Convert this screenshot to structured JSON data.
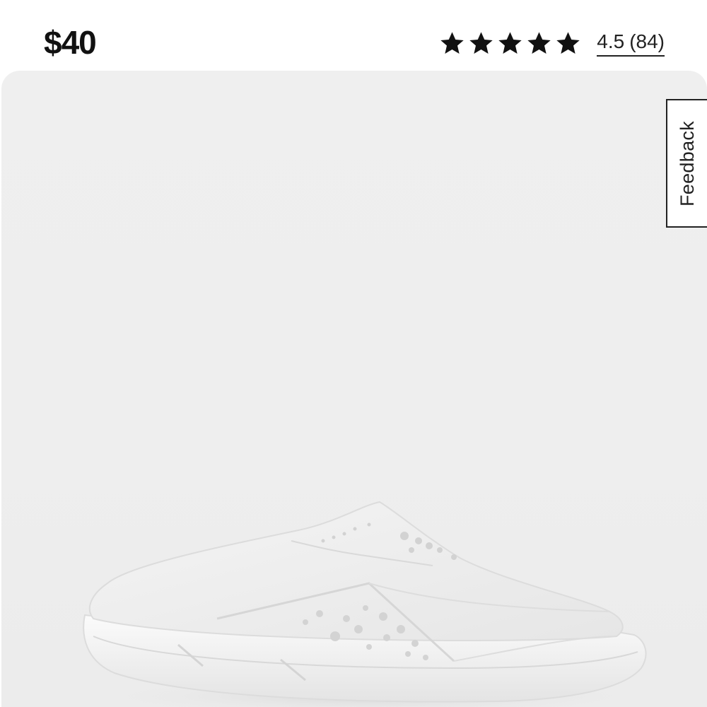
{
  "product": {
    "price": "$40",
    "rating": {
      "stars_filled": 5,
      "stars_total": 5,
      "value_label": "4.5",
      "count_label": "(84)"
    },
    "image": {
      "subject": "white slip-on mule shoe",
      "background_color": "#eeeeee"
    }
  },
  "feedback": {
    "label": "Feedback"
  },
  "icons": {
    "star": "star-icon"
  },
  "colors": {
    "text": "#111111",
    "page_background": "#ffffff",
    "image_background": "#eeeeee"
  }
}
